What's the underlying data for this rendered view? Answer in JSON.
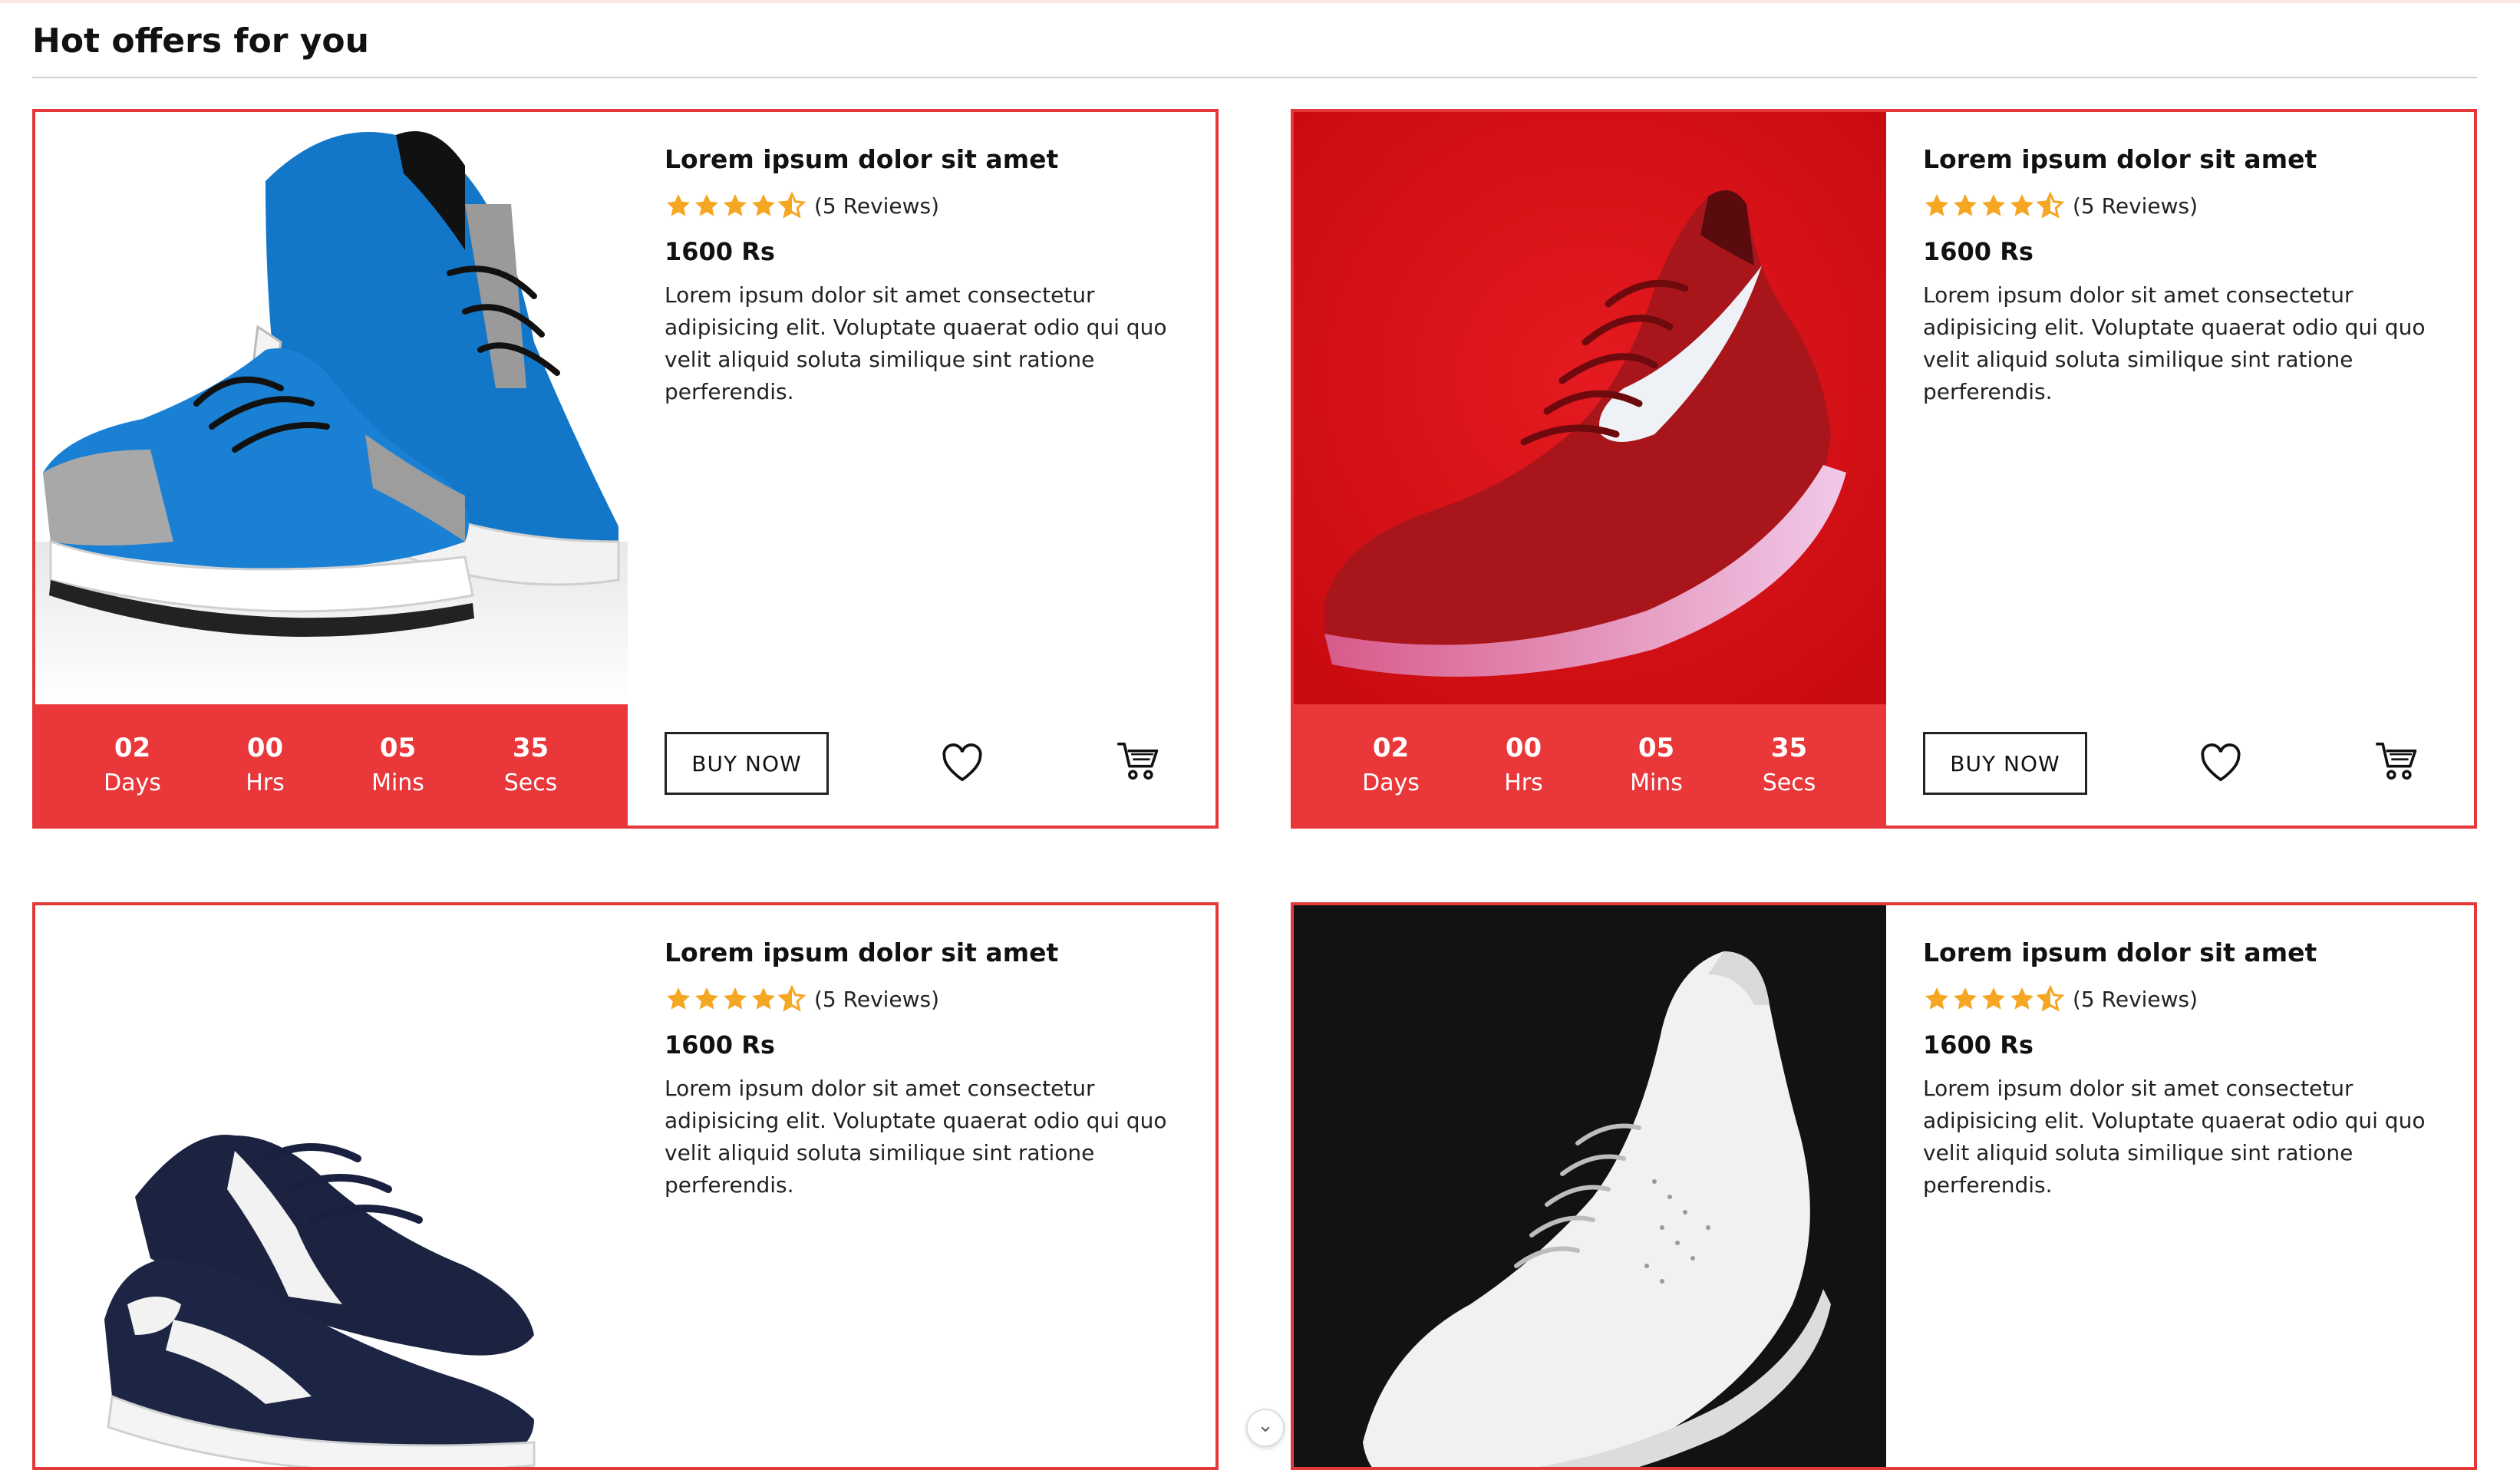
{
  "section": {
    "title": "Hot offers for you"
  },
  "colors": {
    "accent": "#e9373a",
    "border": "#e5383b",
    "star": "#f5a623"
  },
  "products": [
    {
      "title": "Lorem ipsum dolor sit amet",
      "rating": 4.5,
      "reviews": "(5 Reviews)",
      "price": "1600 Rs",
      "description": "Lorem ipsum dolor sit amet consectetur adipisicing elit. Voluptate quaerat odio qui quo velit aliquid soluta similique sint ratione perferendis.",
      "image": "blue-sneaker-image",
      "countdown": {
        "days": "02",
        "days_label": "Days",
        "hrs": "00",
        "hrs_label": "Hrs",
        "mins": "05",
        "mins_label": "Mins",
        "secs": "35",
        "secs_label": "Secs"
      },
      "buy_label": "BUY NOW"
    },
    {
      "title": "Lorem ipsum dolor sit amet",
      "rating": 4.5,
      "reviews": "(5 Reviews)",
      "price": "1600 Rs",
      "description": "Lorem ipsum dolor sit amet consectetur adipisicing elit. Voluptate quaerat odio qui quo velit aliquid soluta similique sint ratione perferendis.",
      "image": "red-nike-sneaker-image",
      "countdown": {
        "days": "02",
        "days_label": "Days",
        "hrs": "00",
        "hrs_label": "Hrs",
        "mins": "05",
        "mins_label": "Mins",
        "secs": "35",
        "secs_label": "Secs"
      },
      "buy_label": "BUY NOW"
    },
    {
      "title": "Lorem ipsum dolor sit amet",
      "rating": 4.5,
      "reviews": "(5 Reviews)",
      "price": "1600 Rs",
      "description": "Lorem ipsum dolor sit amet consectetur adipisicing elit. Voluptate quaerat odio qui quo velit aliquid soluta similique sint ratione perferendis.",
      "image": "navy-puma-sneaker-image"
    },
    {
      "title": "Lorem ipsum dolor sit amet",
      "rating": 4.5,
      "reviews": "(5 Reviews)",
      "price": "1600 Rs",
      "description": "Lorem ipsum dolor sit amet consectetur adipisicing elit. Voluptate quaerat odio qui quo velit aliquid soluta similique sint ratione perferendis.",
      "image": "white-puma-sneaker-image"
    }
  ],
  "icons": {
    "heart": "heart-icon",
    "cart": "cart-icon",
    "scroll": "chevron-down-icon"
  }
}
